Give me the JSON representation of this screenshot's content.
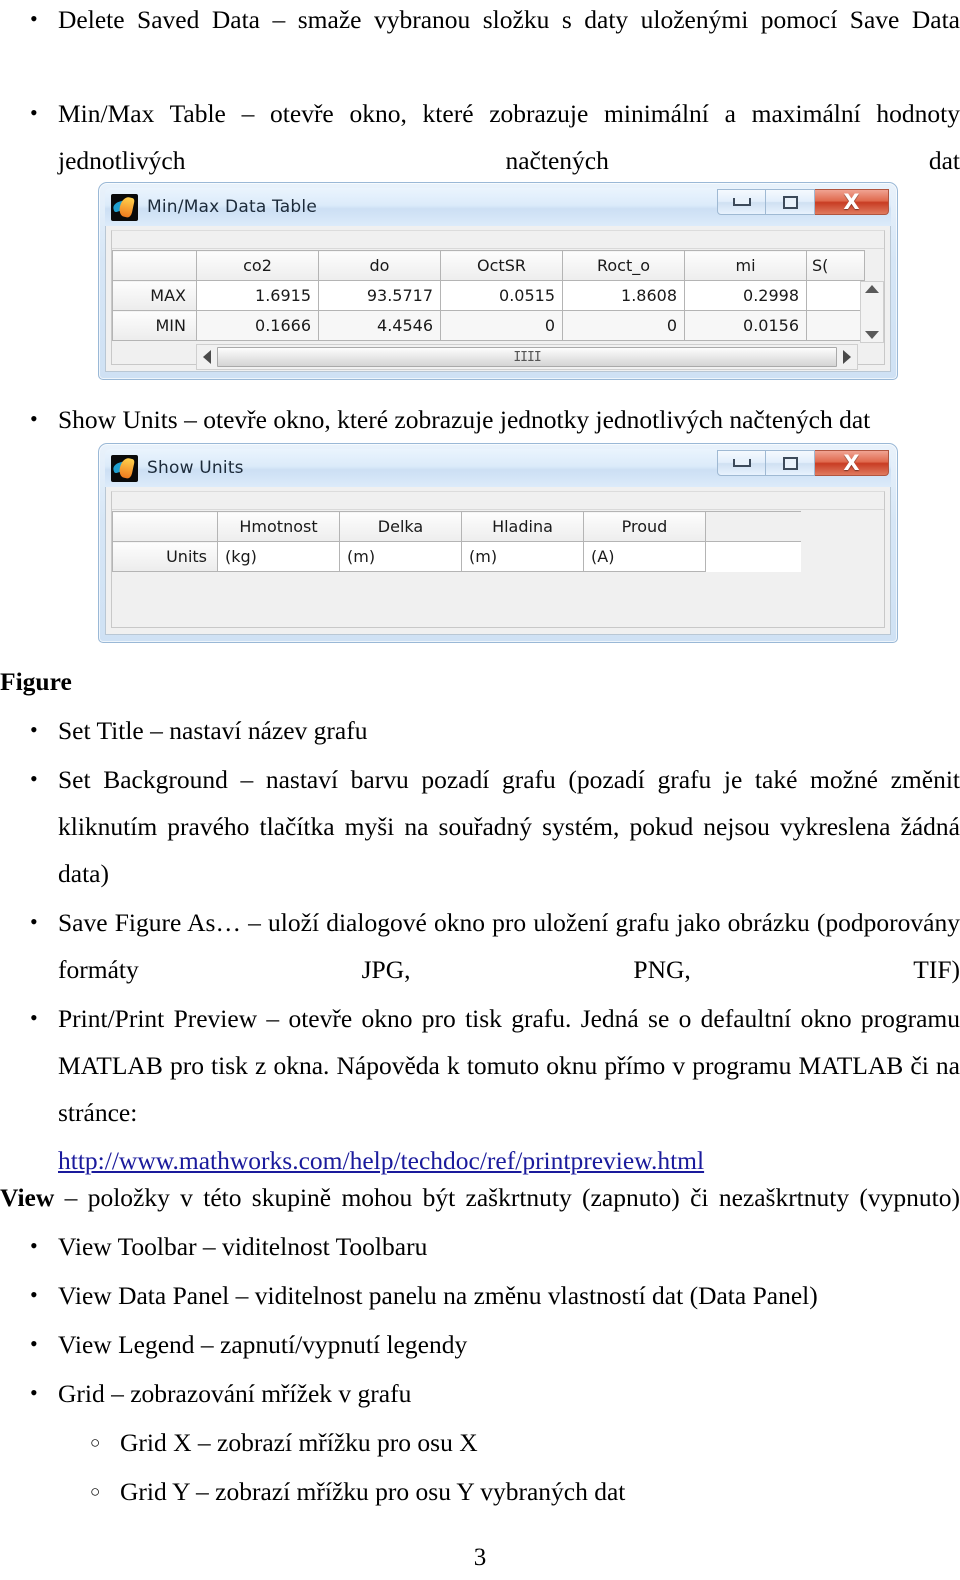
{
  "document": {
    "bullets_top": [
      "Delete Saved Data – smaže vybranou složku s daty uloženými pomocí Save Data",
      "Min/Max Table – otevře okno, které zobrazuje minimální a maximální hodnoty jednotlivých načtených dat"
    ],
    "bullet_show_units": "Show Units – otevře okno, které zobrazuje jednotky jednotlivých načtených dat",
    "figure_heading": "Figure",
    "figure_bullets": [
      "Set Title – nastaví název grafu",
      "Set Background – nastaví barvu pozadí grafu (pozadí grafu je také možné změnit kliknutím pravého tlačítka myši na souřadný systém, pokud nejsou vykreslena žádná data)",
      "Save Figure As… – uloží dialogové okno pro uložení grafu jako obrázku (podporovány formáty JPG, PNG, TIF)",
      "Print/Print Preview – otevře okno pro tisk grafu. Jedná se o defaultní okno programu MATLAB pro tisk z okna. Nápověda k tomuto oknu přímo v programu MATLAB či na stránce:"
    ],
    "link": {
      "text": "http://www.mathworks.com/help/techdoc/ref/printpreview.html",
      "color": "#1a1a9c"
    },
    "view_heading": "View",
    "view_intro": " – položky v této skupině mohou být zaškrtnuty (zapnuto) či nezaškrtnuty (vypnuto)",
    "view_bullets": [
      "View Toolbar – viditelnost Toolbaru",
      "View Data Panel – viditelnost panelu na změnu vlastností dat (Data Panel)",
      "View Legend – zapnutí/vypnutí legendy",
      "Grid – zobrazování mřížek v grafu"
    ],
    "grid_sub_bullets": [
      "Grid X – zobrazí mřížku pro osu X",
      "Grid Y – zobrazí mřížku pro osu Y vybraných dat"
    ],
    "page_number": "3"
  },
  "minmax_window": {
    "title": "Min/Max Data Table",
    "icon": "matlab-membrane-icon",
    "buttons": {
      "minimize": "minimize-button",
      "maximize": "maximize-button",
      "close": "close-button",
      "close_glyph": "X"
    },
    "table": {
      "corner": "",
      "columns": [
        "co2",
        "do",
        "OctSR",
        "Roct_o",
        "mi",
        "S("
      ],
      "rows": [
        {
          "label": "MAX",
          "values": [
            "1.6915",
            "93.5717",
            "0.0515",
            "1.8608",
            "0.2998",
            ""
          ]
        },
        {
          "label": "MIN",
          "values": [
            "0.1666",
            "4.4546",
            "0",
            "0",
            "0.0156",
            ""
          ]
        }
      ]
    },
    "scroll": {
      "grip": "IIII",
      "up": "scroll-up-arrow",
      "down": "scroll-down-arrow",
      "left": "scroll-left-arrow",
      "right": "scroll-right-arrow"
    }
  },
  "units_window": {
    "title": "Show Units",
    "icon": "matlab-membrane-icon",
    "buttons": {
      "minimize": "minimize-button",
      "maximize": "maximize-button",
      "close": "close-button",
      "close_glyph": "X"
    },
    "table": {
      "corner": "",
      "columns": [
        "Hmotnost",
        "Delka",
        "Hladina",
        "Proud",
        ""
      ],
      "rows": [
        {
          "label": "Units",
          "values": [
            "(kg)",
            "(m)",
            "(m)",
            "(A)",
            ""
          ]
        }
      ]
    }
  }
}
